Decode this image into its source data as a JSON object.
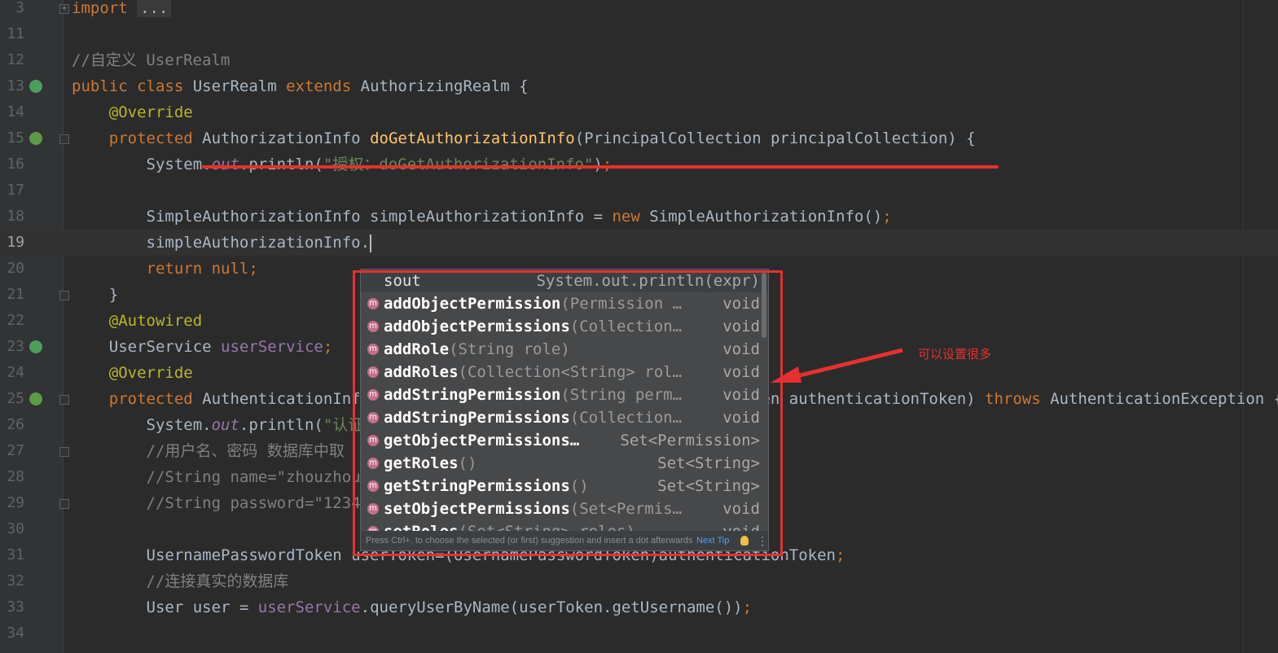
{
  "editor": {
    "lines": [
      {
        "num": "3",
        "segments": [
          {
            "t": "import ",
            "c": "kw"
          },
          {
            "t": "...",
            "c": "fold-box"
          }
        ]
      },
      {
        "num": "11",
        "segments": []
      },
      {
        "num": "12",
        "segments": [
          {
            "t": "//自定义 UserRealm",
            "c": "cmt"
          }
        ]
      },
      {
        "num": "13",
        "segments": [
          {
            "t": "public class ",
            "c": "kw"
          },
          {
            "t": "UserRealm ",
            "c": ""
          },
          {
            "t": "extends ",
            "c": "kw"
          },
          {
            "t": "AuthorizingRealm {",
            "c": ""
          }
        ]
      },
      {
        "num": "14",
        "segments": [
          {
            "t": "    ",
            "c": ""
          },
          {
            "t": "@Override",
            "c": "ann"
          }
        ]
      },
      {
        "num": "15",
        "segments": [
          {
            "t": "    ",
            "c": ""
          },
          {
            "t": "protected ",
            "c": "kw"
          },
          {
            "t": "AuthorizationInfo ",
            "c": ""
          },
          {
            "t": "doGetAuthorizationInfo",
            "c": "fn"
          },
          {
            "t": "(PrincipalCollection principalCollection) {",
            "c": ""
          }
        ]
      },
      {
        "num": "16",
        "segments": [
          {
            "t": "        System.",
            "c": ""
          },
          {
            "t": "out",
            "c": "sfld"
          },
          {
            "t": ".println(",
            "c": ""
          },
          {
            "t": "\"授权：doGetAuthorizationInfo\"",
            "c": "str"
          },
          {
            "t": ")",
            "c": ""
          },
          {
            "t": ";",
            "c": "kw"
          }
        ]
      },
      {
        "num": "17",
        "segments": []
      },
      {
        "num": "18",
        "segments": [
          {
            "t": "        SimpleAuthorizationInfo simpleAuthorizationInfo = ",
            "c": ""
          },
          {
            "t": "new ",
            "c": "kw"
          },
          {
            "t": "SimpleAuthorizationInfo()",
            "c": ""
          },
          {
            "t": ";",
            "c": "kw"
          }
        ]
      },
      {
        "num": "19",
        "segments": [
          {
            "t": "        simpleAuthorizationInfo.",
            "c": ""
          }
        ],
        "current": true
      },
      {
        "num": "20",
        "segments": [
          {
            "t": "        ",
            "c": ""
          },
          {
            "t": "return null;",
            "c": "kw"
          }
        ]
      },
      {
        "num": "21",
        "segments": [
          {
            "t": "    }",
            "c": ""
          }
        ]
      },
      {
        "num": "22",
        "segments": [
          {
            "t": "    ",
            "c": ""
          },
          {
            "t": "@Autowired",
            "c": "ann"
          }
        ]
      },
      {
        "num": "23",
        "segments": [
          {
            "t": "    UserService ",
            "c": ""
          },
          {
            "t": "userService",
            "c": "fld"
          },
          {
            "t": ";",
            "c": "kw"
          }
        ]
      },
      {
        "num": "24",
        "segments": [
          {
            "t": "    ",
            "c": ""
          },
          {
            "t": "@Override",
            "c": "ann"
          }
        ]
      },
      {
        "num": "25",
        "segments": [
          {
            "t": "    ",
            "c": ""
          },
          {
            "t": "protected ",
            "c": "kw"
          },
          {
            "t": "AuthenticationInfo doGetAuthenticationInfo(AuthenticationToken authenticationToken) ",
            "c": ""
          },
          {
            "t": "throws ",
            "c": "kw"
          },
          {
            "t": "AuthenticationException {",
            "c": ""
          }
        ]
      },
      {
        "num": "26",
        "segments": [
          {
            "t": "        System.",
            "c": ""
          },
          {
            "t": "out",
            "c": "sfld"
          },
          {
            "t": ".println(",
            "c": ""
          },
          {
            "t": "\"认证：doGetAuthenticationInfo\"",
            "c": "str"
          },
          {
            "t": ")",
            "c": ""
          },
          {
            "t": ";",
            "c": "kw"
          }
        ]
      },
      {
        "num": "27",
        "segments": [
          {
            "t": "        //用户名、密码 数据库中取",
            "c": "cmt"
          }
        ]
      },
      {
        "num": "28",
        "segments": [
          {
            "t": "        //String name=\"zhouzhou\";",
            "c": "cmt"
          }
        ]
      },
      {
        "num": "29",
        "segments": [
          {
            "t": "        //String password=\"123456\";",
            "c": "cmt"
          }
        ]
      },
      {
        "num": "30",
        "segments": []
      },
      {
        "num": "31",
        "segments": [
          {
            "t": "        UsernamePasswordToken userToken=(UsernamePasswordToken)authenticationToken",
            "c": ""
          },
          {
            "t": ";",
            "c": "kw"
          }
        ]
      },
      {
        "num": "32",
        "segments": [
          {
            "t": "        //连接真实的数据库",
            "c": "cmt"
          }
        ]
      },
      {
        "num": "33",
        "segments": [
          {
            "t": "        User user = ",
            "c": ""
          },
          {
            "t": "userService",
            "c": "fld"
          },
          {
            "t": ".queryUserByName(userToken.getUsername())",
            "c": ""
          },
          {
            "t": ";",
            "c": "kw"
          }
        ]
      },
      {
        "num": "34",
        "segments": []
      }
    ]
  },
  "completion": {
    "items": [
      {
        "name": "sout",
        "params": "",
        "type": "System.out.println(expr)",
        "method": false,
        "selected": true
      },
      {
        "name": "addObjectPermission",
        "params": "(Permission …",
        "type": "void",
        "method": true
      },
      {
        "name": "addObjectPermissions",
        "params": "(Collection…",
        "type": "void",
        "method": true
      },
      {
        "name": "addRole",
        "params": "(String role)",
        "type": "void",
        "method": true
      },
      {
        "name": "addRoles",
        "params": "(Collection<String> rol…",
        "type": "void",
        "method": true
      },
      {
        "name": "addStringPermission",
        "params": "(String perm…",
        "type": "void",
        "method": true
      },
      {
        "name": "addStringPermissions",
        "params": "(Collection…",
        "type": "void",
        "method": true
      },
      {
        "name": "getObjectPermissions…",
        "params": "",
        "type": "Set<Permission>",
        "method": true
      },
      {
        "name": "getRoles",
        "params": "()",
        "type": "Set<String>",
        "method": true
      },
      {
        "name": "getStringPermissions",
        "params": "()",
        "type": "Set<String>",
        "method": true
      },
      {
        "name": "setObjectPermissions",
        "params": "(Set<Permis…",
        "type": "void",
        "method": true
      },
      {
        "name": "setRoles",
        "params": "(Set<String> roles)",
        "type": "void",
        "method": true
      }
    ],
    "method_badge": "m",
    "footer_text": "Press Ctrl+. to choose the selected (or first) suggestion and insert a dot afterwards",
    "next_tip": "Next Tip",
    "more_glyph": "⋮"
  },
  "annotation": {
    "text": "可以设置很多",
    "color": "#e5312f"
  },
  "icons": [
    "fold-icon",
    "class-run-icon",
    "override-icon",
    "autowired-icon",
    "bulb-icon",
    "more-options-icon"
  ]
}
